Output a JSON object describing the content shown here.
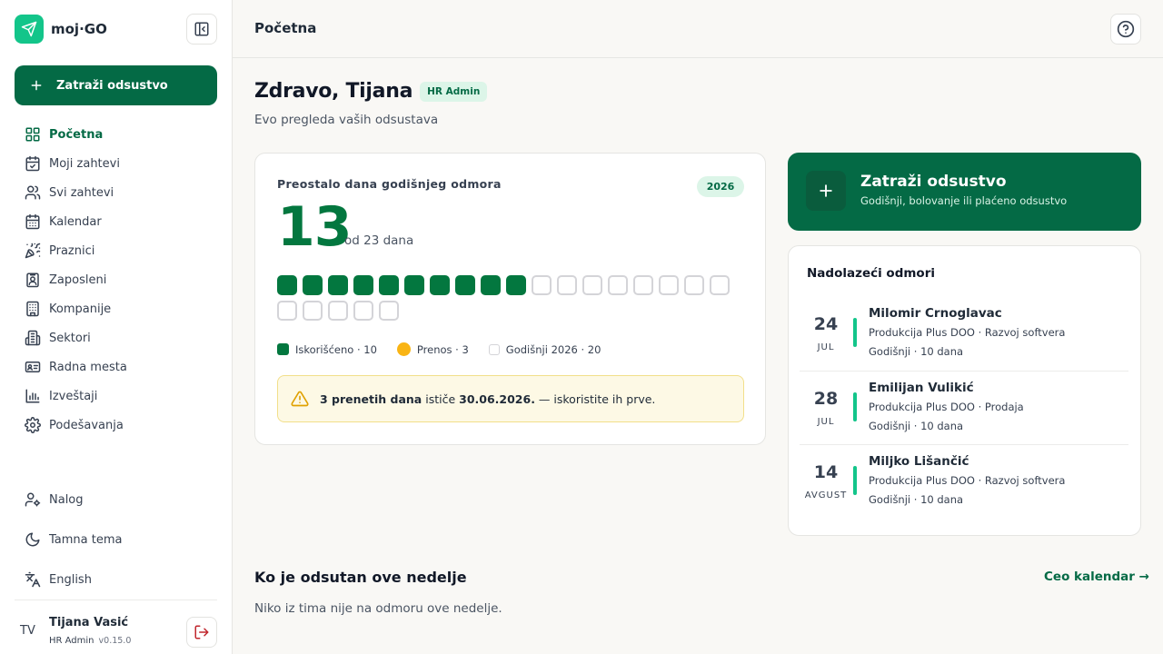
{
  "app": {
    "name": "moj·GO"
  },
  "sidebar": {
    "request_button": "Zatraži odsustvo",
    "items": [
      {
        "label": "Početna",
        "icon": "dashboard-icon",
        "active": true
      },
      {
        "label": "Moji zahtevi",
        "icon": "calendar-check-icon"
      },
      {
        "label": "Svi zahtevi",
        "icon": "users-icon"
      },
      {
        "label": "Kalendar",
        "icon": "calendar-icon"
      },
      {
        "label": "Praznici",
        "icon": "party-popper-icon"
      },
      {
        "label": "Zaposleni",
        "icon": "id-badge-icon"
      },
      {
        "label": "Kompanije",
        "icon": "building-icon"
      },
      {
        "label": "Sektori",
        "icon": "buildings-icon"
      },
      {
        "label": "Radna mesta",
        "icon": "id-card-icon"
      },
      {
        "label": "Izveštaji",
        "icon": "bar-chart-icon"
      },
      {
        "label": "Podešavanja",
        "icon": "gear-icon"
      }
    ],
    "bottom_items": [
      {
        "label": "Nalog",
        "icon": "user-cog-icon"
      },
      {
        "label": "Tamna tema",
        "icon": "moon-icon"
      },
      {
        "label": "English",
        "icon": "translate-icon"
      }
    ],
    "user": {
      "initials": "TV",
      "name": "Tijana Vasić",
      "role": "HR Admin",
      "version": "v0.15.0"
    }
  },
  "topbar": {
    "title": "Početna"
  },
  "greeting": {
    "title": "Zdravo, Tijana",
    "role_badge": "HR Admin",
    "subtitle": "Evo pregleda vaših odsustava"
  },
  "balance": {
    "label": "Preostalo dana godišnjeg odmora",
    "year": "2026",
    "remaining": "13",
    "of_total": "od 23 dana",
    "used_days": 10,
    "total_cells": 23,
    "legend": {
      "used": "Iskorišćeno · 10",
      "carryover": "Prenos · 3",
      "annual": "Godišnji 2026 · 20"
    },
    "warning": {
      "bold_1": "3 prenetih dana",
      "text_1": " ističe ",
      "bold_2": "30.06.2026.",
      "text_2": " — iskoristite ih prve."
    }
  },
  "request_card": {
    "title": "Zatraži odsustvo",
    "subtitle": "Godišnji, bolovanje ili plaćeno odsustvo"
  },
  "upcoming": {
    "title": "Nadolazeći odmori",
    "items": [
      {
        "day": "24",
        "month": "JUL",
        "name": "Milomir Crnoglavac",
        "org": "Produkcija Plus DOO · Razvoj softvera",
        "type": "Godišnji · 10 dana"
      },
      {
        "day": "28",
        "month": "JUL",
        "name": "Emilijan Vulikić",
        "org": "Produkcija Plus DOO · Prodaja",
        "type": "Godišnji · 10 dana"
      },
      {
        "day": "14",
        "month": "AVGUST",
        "name": "Miljko Lišančić",
        "org": "Produkcija Plus DOO · Razvoj softvera",
        "type": "Godišnji · 10 dana"
      }
    ]
  },
  "absent": {
    "title": "Ko je odsutan ove nedelje",
    "calendar_link": "Ceo kalendar →",
    "empty_text": "Niko iz tima nije na odmoru ove nedelje."
  },
  "colors": {
    "brand": "#046a45",
    "accent": "#13c58a",
    "used": "#03773f",
    "carryover": "#f9b414",
    "warning_bg": "#fdf9e5"
  }
}
